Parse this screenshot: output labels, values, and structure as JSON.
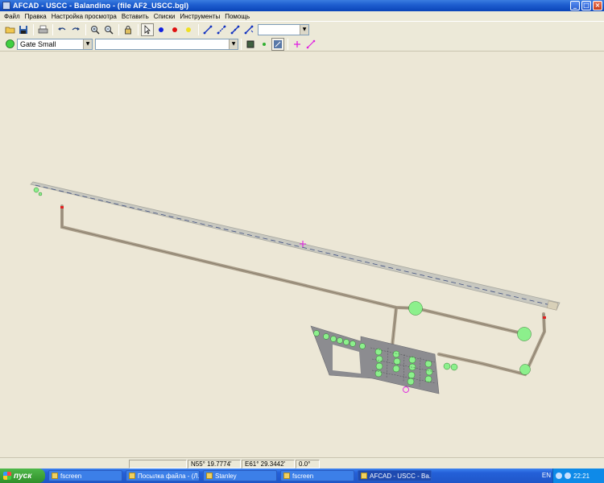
{
  "window": {
    "title": "AFCAD - USCC - Balandino - (file AF2_USCC.bgl)",
    "controls": {
      "minimize": "_",
      "maximize": "□",
      "close": "×"
    }
  },
  "menu": [
    "Файл",
    "Правка",
    "Настройка просмотра",
    "Вставить",
    "Списки",
    "Инструменты",
    "Помощь"
  ],
  "toolbar1": {
    "buttons": [
      "open-icon",
      "save-icon",
      "print-icon",
      "undo-icon",
      "redo-icon",
      "zoom-in-icon",
      "zoom-out-icon",
      "lock-icon",
      "select-arrow-icon",
      "blue-point-icon",
      "red-point-icon",
      "yellow-point-icon",
      "link-line-icon",
      "link-line-2-icon",
      "link-line-3-icon",
      "link-line-4-icon"
    ],
    "combo_value": ""
  },
  "toolbar2": {
    "parking_type": "Gate Small",
    "airline_codes": "",
    "buttons": [
      "green-circle-icon",
      "frame-icon",
      "small-green-dot-icon",
      "snap-icon",
      "pink-cross-icon",
      "pink-line-icon"
    ]
  },
  "status": {
    "cell0": "",
    "latitude": "N55° 19.7774'",
    "longitude": "E61° 29.3442'",
    "heading": "0.0°"
  },
  "taskbar": {
    "start_label": "пуск",
    "tasks": [
      "fscreen",
      "Посылка файла - (Л...",
      "Stanley",
      "fscreen",
      "AFCAD - USCC - Ba..."
    ],
    "active_task_index": 4,
    "language": "EN",
    "clock": "22:21"
  },
  "colors": {
    "canvas": "#ece7d6",
    "runway": "#c8c8c0",
    "taxiway": "#a89c88",
    "apron": "#8c8c90",
    "parking": "#8cf08c",
    "runway_marker": "#e020e0"
  }
}
